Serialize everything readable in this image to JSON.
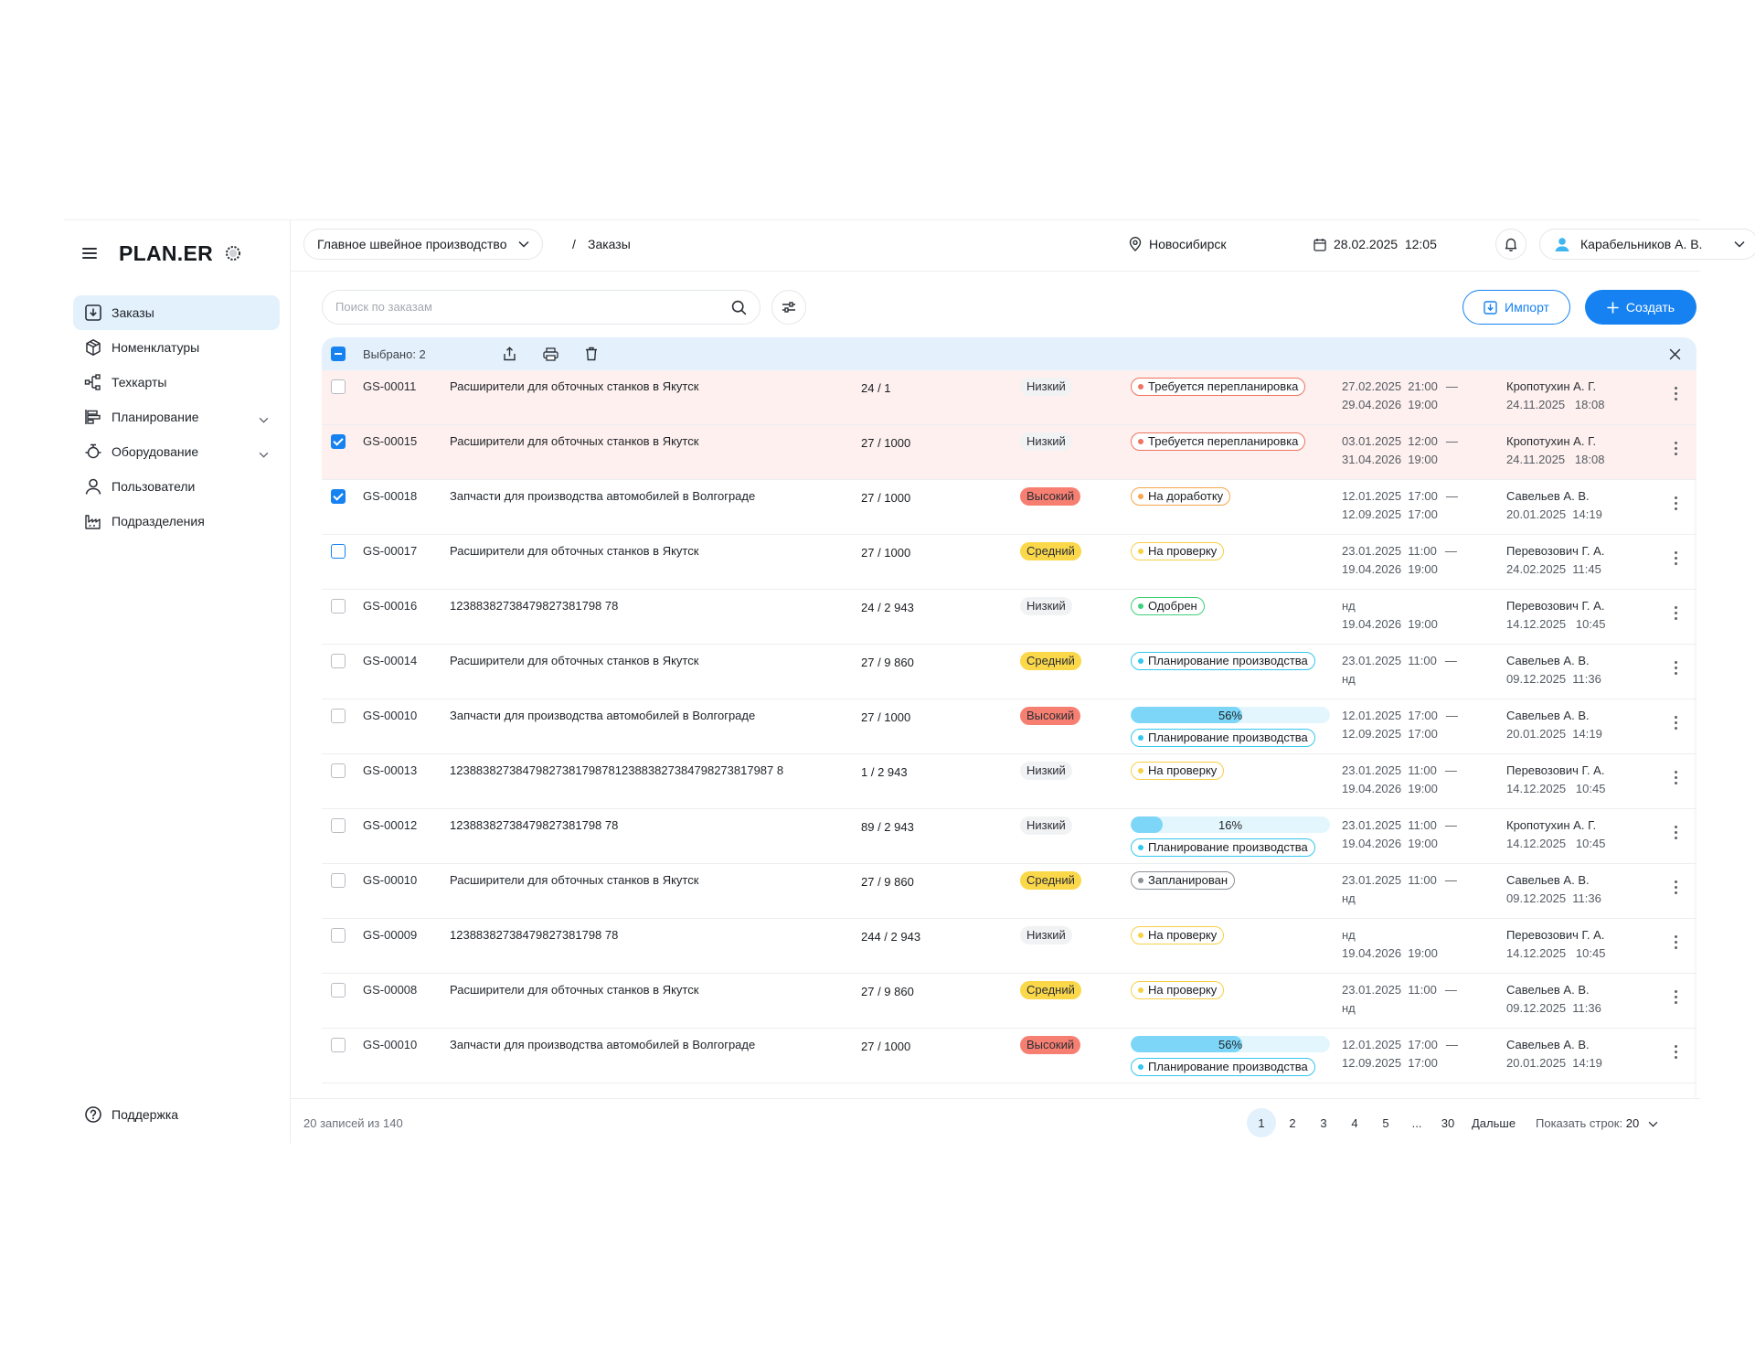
{
  "brand": {
    "name": "PLAN.ER"
  },
  "sidebar": {
    "items": [
      {
        "label": "Заказы",
        "icon": "download-box-icon",
        "active": true
      },
      {
        "label": "Номенклатуры",
        "icon": "cube-icon"
      },
      {
        "label": "Техкарты",
        "icon": "flow-icon"
      },
      {
        "label": "Планирование",
        "icon": "gantt-icon",
        "expandable": true
      },
      {
        "label": "Оборудование",
        "icon": "machine-icon",
        "expandable": true
      },
      {
        "label": "Пользователи",
        "icon": "user-icon"
      },
      {
        "label": "Подразделения",
        "icon": "factory-icon"
      }
    ],
    "support": "Поддержка"
  },
  "header": {
    "org": "Главное швейное производство",
    "crumb_sep": "/",
    "crumb": "Заказы",
    "city": "Новосибирск",
    "datetime": "28.02.2025  12:05",
    "user": "Карабельников А. В."
  },
  "toolbar": {
    "search_placeholder": "Поиск по заказам",
    "import_label": "Импорт",
    "create_label": "Создать"
  },
  "selection": {
    "label": "Выбрано: 2"
  },
  "colors": {
    "accent": "#1682f1",
    "warn_row": "#fdf0ee",
    "priority_low": "#f1f2f4",
    "priority_mid": "#fbd74a",
    "priority_high": "#f77f72",
    "status_red": "#f0735f",
    "status_orange": "#f6a54a",
    "status_yellow": "#f7d046",
    "status_green": "#3fd07a",
    "status_cyan": "#33c7ee",
    "status_gray": "#8c9198"
  },
  "rows": [
    {
      "id": "GS-00011",
      "name": "Расширители для обточных станков в Якутск",
      "qty": "24 / 1",
      "priority": "Низкий",
      "prio": "low",
      "status": "Требуется перепланировка",
      "st": "red",
      "d1": "27.02.2025  21:00",
      "d1dash": true,
      "d2": "29.04.2026  19:00",
      "author": "Кропотухин А. Г.",
      "when": "24.11.2025   18:08",
      "warn": true,
      "checked": false
    },
    {
      "id": "GS-00015",
      "name": "Расширители для обточных станков в Якутск",
      "qty": "27 / 1000",
      "priority": "Низкий",
      "prio": "low",
      "status": "Требуется перепланировка",
      "st": "red",
      "d1": "03.01.2025  12:00",
      "d1dash": true,
      "d2": "31.04.2026  19:00",
      "author": "Кропотухин А. Г.",
      "when": "24.11.2025   18:08",
      "warn": true,
      "checked": true
    },
    {
      "id": "GS-00018",
      "name": "Запчасти для производства автомобилей в Волгограде",
      "qty": "27 / 1000",
      "priority": "Высокий",
      "prio": "high",
      "status": "На доработку",
      "st": "orange",
      "d1": "12.01.2025  17:00",
      "d1dash": true,
      "d2": "12.09.2025  17:00",
      "author": "Савельев А. В.",
      "when": "20.01.2025  14:19",
      "checked": true
    },
    {
      "id": "GS-00017",
      "name": "Расширители для обточных станков в Якутск",
      "qty": "27 / 1000",
      "priority": "Средний",
      "prio": "mid",
      "status": "На проверку",
      "st": "yellow",
      "d1": "23.01.2025  11:00",
      "d1dash": true,
      "d2": "19.04.2026  19:00",
      "author": "Перевозович Г. А.",
      "when": "24.02.2025  11:45",
      "checked": false,
      "hover": true
    },
    {
      "id": "GS-00016",
      "name": "12388382738479827381798 78",
      "qty": "24 / 2 943",
      "priority": "Низкий",
      "prio": "low",
      "status": "Одобрен",
      "st": "green",
      "d1": "нд",
      "d1dash": false,
      "d2": "19.04.2026  19:00",
      "author": "Перевозович Г. А.",
      "when": "14.12.2025   10:45",
      "checked": false
    },
    {
      "id": "GS-00014",
      "name": "Расширители для обточных станков в Якутск",
      "qty": "27 / 9 860",
      "priority": "Средний",
      "prio": "mid",
      "status": "Планирование производства",
      "st": "cyan",
      "d1": "23.01.2025  11:00",
      "d1dash": true,
      "d2": "нд",
      "author": "Савельев А. В.",
      "when": "09.12.2025  11:36",
      "checked": false
    },
    {
      "id": "GS-00010",
      "name": "Запчасти для производства автомобилей в Волгограде",
      "qty": "27 / 1000",
      "priority": "Высокий",
      "prio": "high",
      "status": "Планирование производства",
      "st": "cyan",
      "progress": 56,
      "progress_label": "56%",
      "d1": "12.01.2025  17:00",
      "d1dash": true,
      "d2": "12.09.2025  17:00",
      "author": "Савельев А. В.",
      "when": "20.01.2025  14:19",
      "checked": false
    },
    {
      "id": "GS-00013",
      "name": "1238838273847982738179878123883827384798273817987 8",
      "qty": "1 / 2 943",
      "priority": "Низкий",
      "prio": "low",
      "status": "На проверку",
      "st": "yellow",
      "d1": "23.01.2025  11:00",
      "d1dash": true,
      "d2": "19.04.2026  19:00",
      "author": "Перевозович Г. А.",
      "when": "14.12.2025   10:45",
      "checked": false
    },
    {
      "id": "GS-00012",
      "name": "12388382738479827381798 78",
      "qty": "89 / 2 943",
      "priority": "Низкий",
      "prio": "low",
      "status": "Планирование производства",
      "st": "cyan",
      "progress": 16,
      "progress_label": "16%",
      "d1": "23.01.2025  11:00",
      "d1dash": true,
      "d2": "19.04.2026  19:00",
      "author": "Кропотухин А. Г.",
      "when": "14.12.2025   10:45",
      "checked": false
    },
    {
      "id": "GS-00010",
      "name": "Расширители для обточных станков в Якутск",
      "qty": "27 / 9 860",
      "priority": "Средний",
      "prio": "mid",
      "status": "Запланирован",
      "st": "gray",
      "d1": "23.01.2025  11:00",
      "d1dash": true,
      "d2": "нд",
      "author": "Савельев А. В.",
      "when": "09.12.2025  11:36",
      "checked": false
    },
    {
      "id": "GS-00009",
      "name": "12388382738479827381798 78",
      "qty": "244 / 2 943",
      "priority": "Низкий",
      "prio": "low",
      "status": "На проверку",
      "st": "yellow",
      "d1": "нд",
      "d1dash": false,
      "d2": "19.04.2026  19:00",
      "author": "Перевозович Г. А.",
      "when": "14.12.2025   10:45",
      "checked": false
    },
    {
      "id": "GS-00008",
      "name": "Расширители для обточных станков в Якутск",
      "qty": "27 / 9 860",
      "priority": "Средний",
      "prio": "mid",
      "status": "На проверку",
      "st": "yellow",
      "d1": "23.01.2025  11:00",
      "d1dash": true,
      "d2": "нд",
      "author": "Савельев А. В.",
      "when": "09.12.2025  11:36",
      "checked": false
    },
    {
      "id": "GS-00010",
      "name": "Запчасти для производства автомобилей в Волгограде",
      "qty": "27 / 1000",
      "priority": "Высокий",
      "prio": "high",
      "status": "Планирование производства",
      "st": "cyan",
      "progress": 56,
      "progress_label": "56%",
      "d1": "12.01.2025  17:00",
      "d1dash": true,
      "d2": "12.09.2025  17:00",
      "author": "Савельев А. В.",
      "when": "20.01.2025  14:19",
      "checked": false
    }
  ],
  "dash": "—",
  "footer": {
    "count": "20 записей из 140",
    "pages": [
      "1",
      "2",
      "3",
      "4",
      "5",
      "...",
      "30"
    ],
    "current_page": "1",
    "next": "Дальше",
    "rows_label": "Показать строк:",
    "rows_value": "20"
  }
}
